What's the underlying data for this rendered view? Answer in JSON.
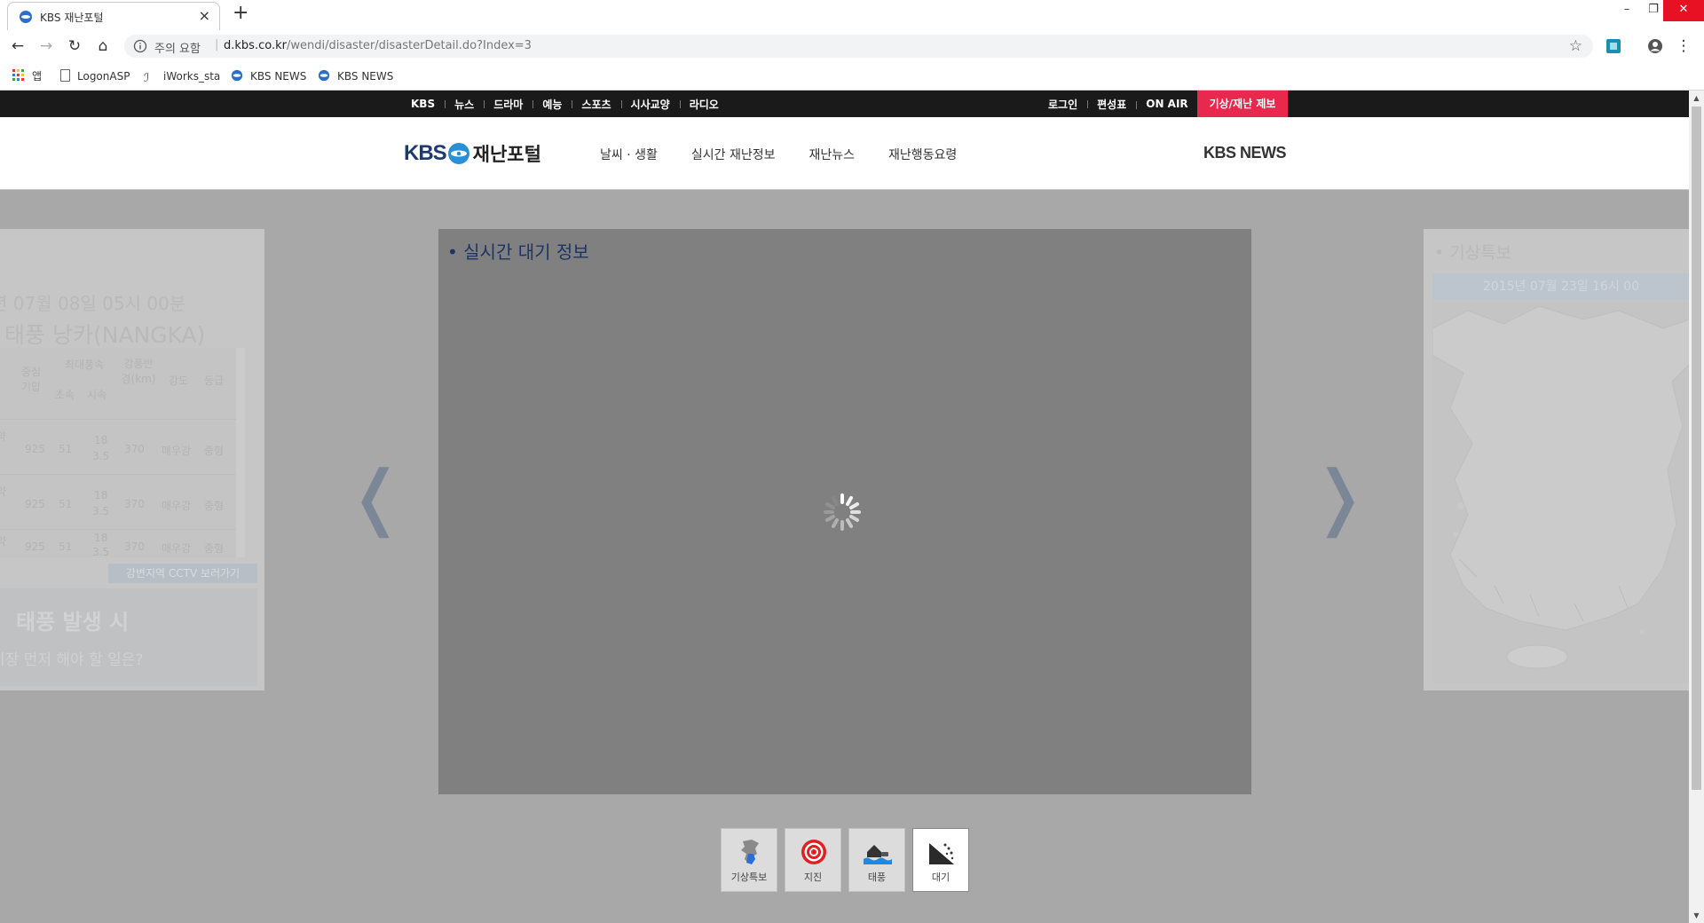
{
  "browser": {
    "tab_title": "KBS 재난포털",
    "address": {
      "security": "주의 요함",
      "host": "d.kbs.co.kr",
      "path": "/wendi/disaster/disasterDetail.do?Index=3"
    },
    "bookmarks": [
      "앱",
      "LogonASP",
      "iWorks_sta",
      "KBS NEWS",
      "KBS NEWS"
    ]
  },
  "topnav": {
    "left": [
      "KBS",
      "뉴스",
      "드라마",
      "예능",
      "스포츠",
      "시사교양",
      "라디오"
    ],
    "right": [
      "로그인",
      "편성표",
      "ON AIR"
    ],
    "report": "기상/재난 제보"
  },
  "header": {
    "logo_kbs": "KBS",
    "logo_portal": "재난포털",
    "menu": [
      "날씨 · 생활",
      "실시간 재난정보",
      "재난뉴스",
      "재난행동요령"
    ],
    "kbs_news": "KBS NEWS"
  },
  "left_card": {
    "date": "년 07월 08일 05시 00분",
    "typhoon_name": "태풍 낭카(NANGKA)",
    "table_headers": [
      "중심기압",
      "최대풍속",
      "초속",
      "시속",
      "강풍반경(km)",
      "강도",
      "등급"
    ],
    "rows": [
      [
        "약",
        "925",
        "51",
        "18",
        "3.5",
        "370",
        "매우강",
        "중형"
      ],
      [
        "약",
        "925",
        "51",
        "18",
        "3.5",
        "370",
        "매우강",
        "중형"
      ],
      [
        "약",
        "925",
        "51",
        "18",
        "3.5",
        "370",
        "매우강",
        "중형"
      ]
    ],
    "cctv_button": "강변지역 CCTV 보러가기",
    "banner_title": "태풍 발생 시",
    "banner_sub": "시장 먼저 해야 할 일은?"
  },
  "center_card": {
    "title": "• 실시간 대기 정보"
  },
  "right_card": {
    "title": "• 기상특보",
    "date": "2015년 07월 23일 16시 00"
  },
  "categories": [
    {
      "label": "기상특보",
      "active": false,
      "icon": "korea-map-icon"
    },
    {
      "label": "지진",
      "active": false,
      "icon": "earthquake-target-icon"
    },
    {
      "label": "태풍",
      "active": false,
      "icon": "flood-house-icon"
    },
    {
      "label": "대기",
      "active": true,
      "icon": "landslide-icon"
    }
  ],
  "colors": {
    "report_red": "#e8284c",
    "kbs_navy": "#1e3a6e",
    "title_navy": "#1e3366"
  }
}
